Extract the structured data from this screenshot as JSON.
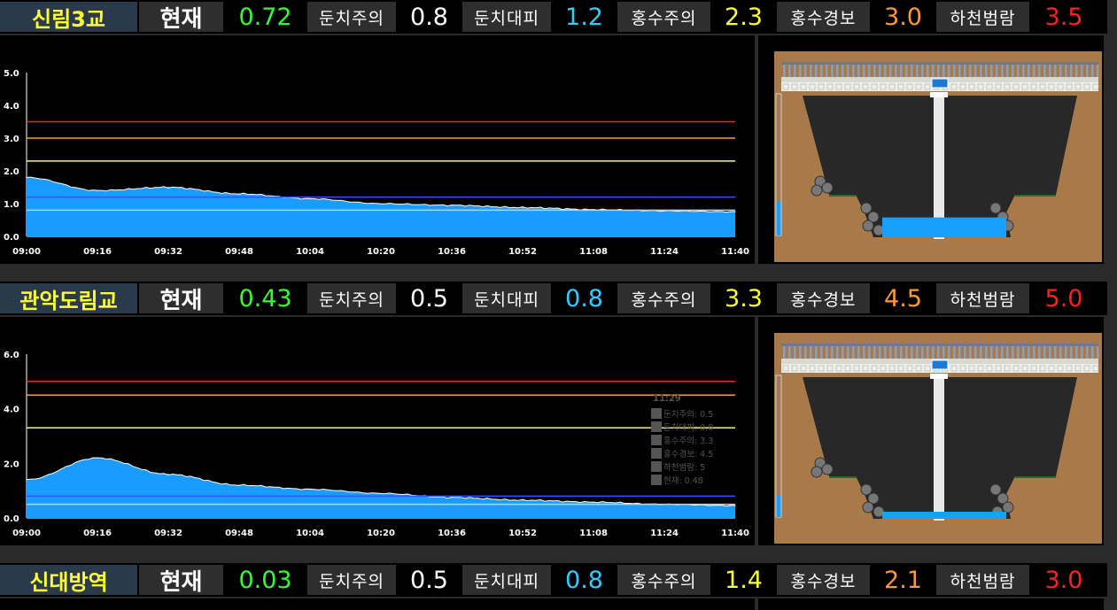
{
  "stations": [
    {
      "name": "신림3교",
      "current_label": "현재",
      "current": "0.72",
      "levels": [
        {
          "label": "둔치주의",
          "value": "0.8",
          "color": "#ffffff"
        },
        {
          "label": "둔치대피",
          "value": "1.2",
          "color": "#33ccff"
        },
        {
          "label": "홍수주의",
          "value": "2.3",
          "color": "#ffff33"
        },
        {
          "label": "홍수경보",
          "value": "3.0",
          "color": "#ff9933"
        },
        {
          "label": "하천범람",
          "value": "3.5",
          "color": "#ff2222"
        }
      ],
      "chart_data": {
        "type": "area",
        "x": [
          "09:00",
          "09:16",
          "09:32",
          "09:48",
          "10:04",
          "10:20",
          "10:36",
          "10:52",
          "11:08",
          "11:24",
          "11:40"
        ],
        "ylim": [
          0,
          5
        ],
        "yticks": [
          "0.0",
          "1.0",
          "2.0",
          "3.0",
          "4.0",
          "5.0"
        ],
        "values": [
          1.8,
          1.4,
          1.5,
          1.3,
          1.15,
          1.0,
          0.95,
          0.88,
          0.82,
          0.78,
          0.75
        ],
        "thresholds": [
          {
            "value": 0.8,
            "color": "#cccccc"
          },
          {
            "value": 1.2,
            "color": "#3355ff"
          },
          {
            "value": 2.3,
            "color": "#ffff33"
          },
          {
            "value": 3.0,
            "color": "#ff9933"
          },
          {
            "value": 3.5,
            "color": "#ff2222"
          }
        ],
        "tooltip": null
      },
      "water_fill": 0.14
    },
    {
      "name": "관악도림교",
      "current_label": "현재",
      "current": "0.43",
      "levels": [
        {
          "label": "둔치주의",
          "value": "0.5",
          "color": "#ffffff"
        },
        {
          "label": "둔치대피",
          "value": "0.8",
          "color": "#33ccff"
        },
        {
          "label": "홍수주의",
          "value": "3.3",
          "color": "#ffff33"
        },
        {
          "label": "홍수경보",
          "value": "4.5",
          "color": "#ff9933"
        },
        {
          "label": "하천범람",
          "value": "5.0",
          "color": "#ff2222"
        }
      ],
      "chart_data": {
        "type": "area",
        "x": [
          "09:00",
          "09:16",
          "09:32",
          "09:48",
          "10:04",
          "10:20",
          "10:36",
          "10:52",
          "11:08",
          "11:24",
          "11:40"
        ],
        "ylim": [
          0,
          6
        ],
        "yticks": [
          "0.0",
          "2.0",
          "4.0",
          "6.0"
        ],
        "values": [
          1.4,
          2.2,
          1.6,
          1.2,
          1.05,
          0.9,
          0.75,
          0.65,
          0.58,
          0.5,
          0.45
        ],
        "thresholds": [
          {
            "value": 0.5,
            "color": "#cccccc"
          },
          {
            "value": 0.8,
            "color": "#3355ff"
          },
          {
            "value": 3.3,
            "color": "#ffff33"
          },
          {
            "value": 4.5,
            "color": "#ff9933"
          },
          {
            "value": 5.0,
            "color": "#ff2222"
          }
        ],
        "tooltip": {
          "time": "11:29",
          "lines": [
            "둔치주의: 0.5",
            "둔치대피: 0.8",
            "홍수주의: 3.3",
            "홍수경보: 4.5",
            "하천범람: 5",
            "현재: 0.48"
          ]
        }
      },
      "water_fill": 0.05
    },
    {
      "name": "신대방역",
      "current_label": "현재",
      "current": "0.03",
      "levels": [
        {
          "label": "둔치주의",
          "value": "0.5",
          "color": "#ffffff"
        },
        {
          "label": "둔치대피",
          "value": "0.8",
          "color": "#33ccff"
        },
        {
          "label": "홍수주의",
          "value": "1.4",
          "color": "#ffff33"
        },
        {
          "label": "홍수경보",
          "value": "2.1",
          "color": "#ff9933"
        },
        {
          "label": "하천범람",
          "value": "3.0",
          "color": "#ff2222"
        }
      ]
    }
  ],
  "colors": {
    "current": "#33ff33",
    "area": "#1a9cff",
    "name": "#ffff33"
  }
}
